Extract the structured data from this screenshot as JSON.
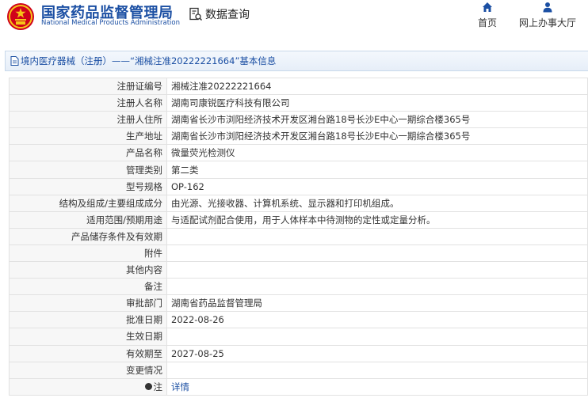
{
  "header": {
    "agency_cn": "国家药品监督管理局",
    "agency_en": "National Medical Products Administration",
    "data_query": "数据查询",
    "nav": {
      "home": "首页",
      "online_hall": "网上办事大厅"
    }
  },
  "title_bar": {
    "text": "境内医疗器械（注册）——“湘械注准20222221664”基本信息"
  },
  "rows": [
    {
      "label": "注册证编号",
      "value": "湘械注准20222221664"
    },
    {
      "label": "注册人名称",
      "value": "湖南司康锐医疗科技有限公司"
    },
    {
      "label": "注册人住所",
      "value": "湖南省长沙市浏阳经济技术开发区湘台路18号长沙E中心一期综合楼365号"
    },
    {
      "label": "生产地址",
      "value": "湖南省长沙市浏阳经济技术开发区湘台路18号长沙E中心一期综合楼365号"
    },
    {
      "label": "产品名称",
      "value": "微量荧光检测仪"
    },
    {
      "label": "管理类别",
      "value": "第二类"
    },
    {
      "label": "型号规格",
      "value": "OP-162"
    },
    {
      "label": "结构及组成/主要组成成分",
      "value": "由光源、光接收器、计算机系统、显示器和打印机组成。"
    },
    {
      "label": "适用范围/预期用途",
      "value": "与适配试剂配合使用，用于人体样本中待测物的定性或定量分析。"
    },
    {
      "label": "产品储存条件及有效期",
      "value": ""
    },
    {
      "label": "附件",
      "value": ""
    },
    {
      "label": "其他内容",
      "value": ""
    },
    {
      "label": "备注",
      "value": ""
    },
    {
      "label": "审批部门",
      "value": "湖南省药品监督管理局"
    },
    {
      "label": "批准日期",
      "value": "2022-08-26"
    },
    {
      "label": "生效日期",
      "value": ""
    },
    {
      "label": "有效期至",
      "value": "2027-08-25"
    },
    {
      "label": "变更情况",
      "value": ""
    }
  ],
  "note_row": {
    "label": "注",
    "link": "详情"
  },
  "colors": {
    "brand_blue": "#1b4fa3",
    "emblem_red": "#d0021b",
    "emblem_gold": "#f5c518"
  },
  "icons": {
    "emblem": "national-emblem-icon",
    "data_query": "document-search-icon",
    "home": "home-icon",
    "online_hall": "user-icon",
    "title": "document-icon",
    "note": "dot-icon"
  }
}
